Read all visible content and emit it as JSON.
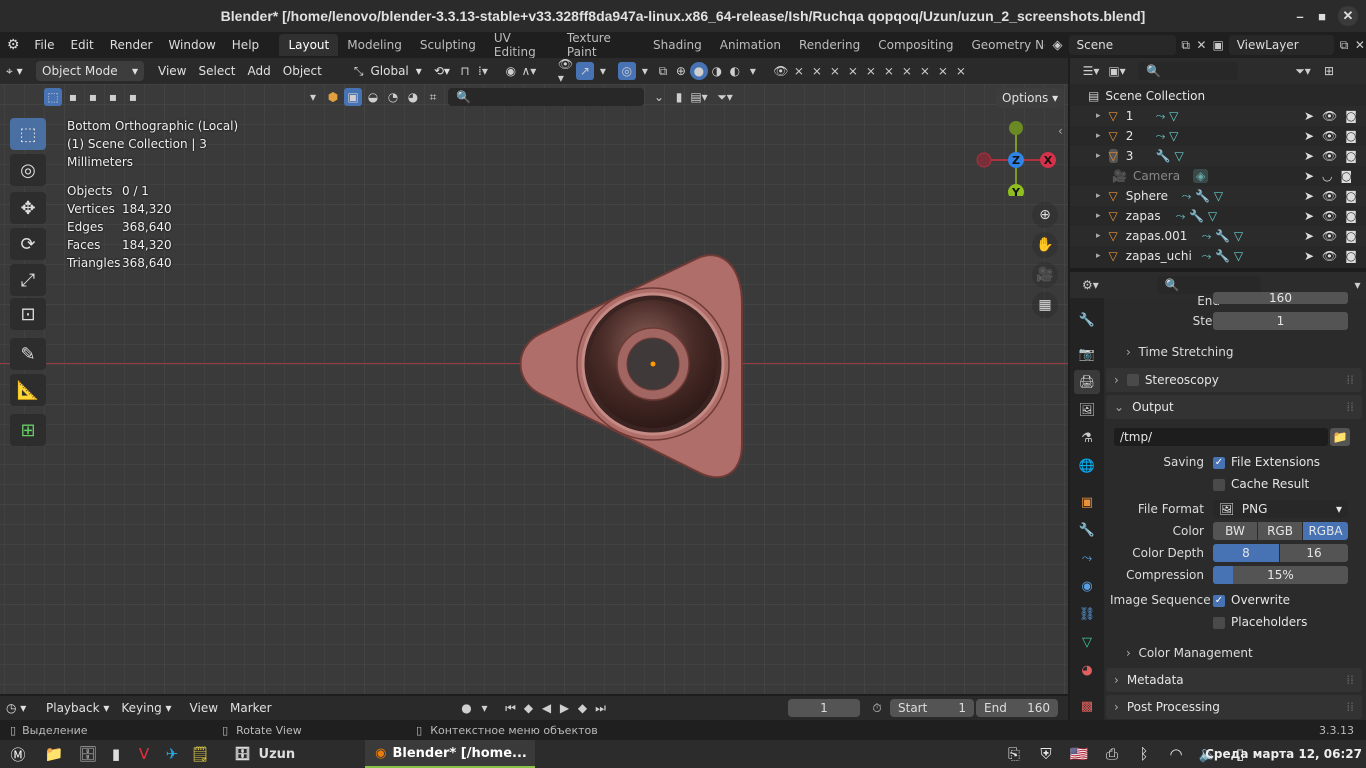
{
  "window": {
    "title": "Blender* [/home/lenovo/blender-3.3.13-stable+v33.328ff8da947a-linux.x86_64-release/Ish/Ruchqa qopqoq/Uzun/uzun_2_screenshots.blend]"
  },
  "menu": {
    "items": [
      "File",
      "Edit",
      "Render",
      "Window",
      "Help"
    ]
  },
  "workspaces": [
    "Layout",
    "Modeling",
    "Sculpting",
    "UV Editing",
    "Texture Paint",
    "Shading",
    "Animation",
    "Rendering",
    "Compositing",
    "Geometry Noc"
  ],
  "active_workspace": "Layout",
  "scene": {
    "name": "Scene",
    "view_layer": "ViewLayer"
  },
  "viewport": {
    "mode": "Object Mode",
    "menus": [
      "View",
      "Select",
      "Add",
      "Object"
    ],
    "transform": "Global",
    "options_label": "Options",
    "info": {
      "view": "Bottom Orthographic (Local)",
      "collection": "(1) Scene Collection | 3",
      "units": "Millimeters"
    },
    "stats": [
      {
        "label": "Objects",
        "value": "0 / 1"
      },
      {
        "label": "Vertices",
        "value": "184,320"
      },
      {
        "label": "Edges",
        "value": "368,640"
      },
      {
        "label": "Faces",
        "value": "184,320"
      },
      {
        "label": "Triangles",
        "value": "368,640"
      }
    ],
    "gizmo": {
      "z": "Z",
      "x": "X",
      "y": "Y"
    }
  },
  "outliner": {
    "root": "Scene Collection",
    "items": [
      "1",
      "2",
      "3",
      "Camera",
      "Sphere",
      "zapas",
      "zapas.001",
      "zapas_uchi"
    ]
  },
  "properties": {
    "end_label": "End",
    "end_value": "160",
    "step_label": "Step",
    "step_value": "1",
    "time_stretching": "Time Stretching",
    "stereoscopy": "Stereoscopy",
    "output": "Output",
    "path": "/tmp/",
    "saving_label": "Saving",
    "file_extensions": "File Extensions",
    "cache_result": "Cache Result",
    "file_format_label": "File Format",
    "file_format": "PNG",
    "color_label": "Color",
    "color_options": [
      "BW",
      "RGB",
      "RGBA"
    ],
    "color_depth_label": "Color Depth",
    "color_depth": [
      "8",
      "16"
    ],
    "compression_label": "Compression",
    "compression": "15%",
    "compression_fraction": 0.15,
    "image_sequence_label": "Image Sequence",
    "overwrite": "Overwrite",
    "placeholders": "Placeholders",
    "color_management": "Color Management",
    "metadata": "Metadata",
    "post_processing": "Post Processing"
  },
  "timeline": {
    "menus": [
      "Playback",
      "Keying",
      "View",
      "Marker"
    ],
    "frame": "1",
    "start_label": "Start",
    "start_value": "1",
    "end_label": "End",
    "end_value": "160"
  },
  "statusbar": {
    "select": "Выделение",
    "rotate": "Rotate View",
    "context": "Контекстное меню объектов",
    "version": "3.3.13"
  },
  "taskbar": {
    "app1": "Uzun",
    "app2": "Blender* [/home...",
    "clock": "Среда марта 12, 06:27"
  }
}
